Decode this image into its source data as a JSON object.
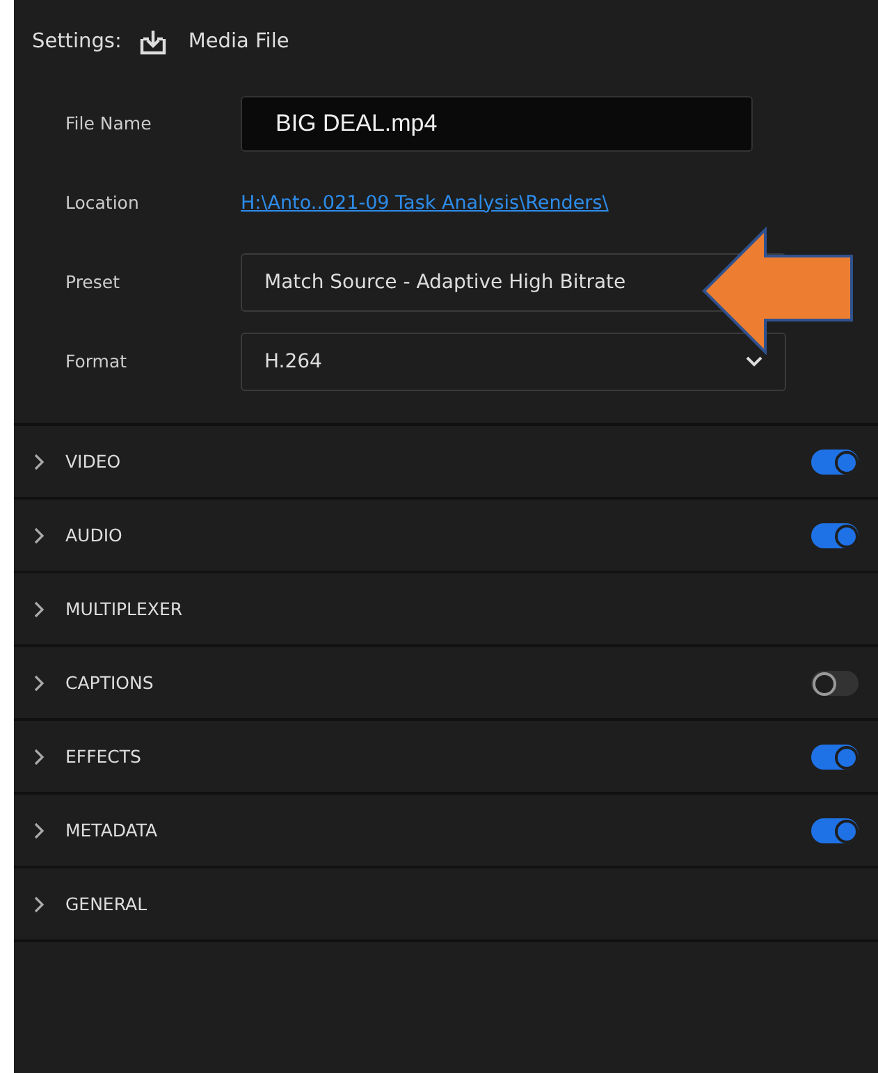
{
  "header": {
    "label": "Settings:",
    "title": "Media File"
  },
  "fields": [
    {
      "kind": "input",
      "label": "File Name",
      "value": "BIG DEAL.mp4"
    },
    {
      "kind": "link",
      "label": "Location",
      "value": "H:\\Anto..021-09 Task Analysis\\Renders\\"
    },
    {
      "kind": "field",
      "label": "Preset",
      "value": "Match Source - Adaptive High Bitrate"
    },
    {
      "kind": "select",
      "label": "Format",
      "value": "H.264"
    }
  ],
  "annotation": {
    "kind": "arrow"
  },
  "sections": [
    {
      "label": "VIDEO",
      "toggle": {
        "on": true
      }
    },
    {
      "label": "AUDIO",
      "toggle": {
        "on": true
      }
    },
    {
      "label": "MULTIPLEXER"
    },
    {
      "label": "CAPTIONS",
      "toggle": {
        "on": false
      }
    },
    {
      "label": "EFFECTS",
      "toggle": {
        "on": true
      }
    },
    {
      "label": "METADATA",
      "toggle": {
        "on": true
      }
    },
    {
      "label": "GENERAL"
    }
  ]
}
